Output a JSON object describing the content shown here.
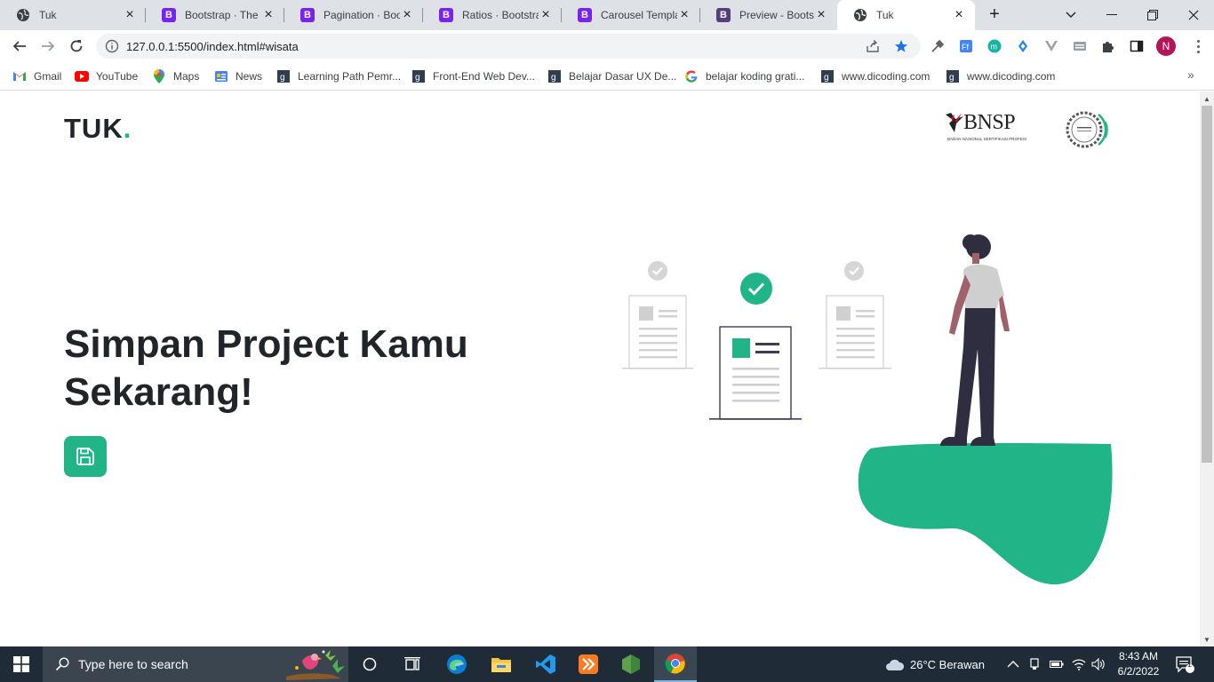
{
  "browser": {
    "tabs": [
      {
        "title": "Tuk",
        "icon": "globe-icon",
        "active": false
      },
      {
        "title": "Bootstrap · The m",
        "icon": "bootstrap-icon",
        "active": false
      },
      {
        "title": "Pagination · Boot",
        "icon": "bootstrap-icon",
        "active": false
      },
      {
        "title": "Ratios · Bootstrap",
        "icon": "bootstrap-icon",
        "active": false
      },
      {
        "title": "Carousel Templat",
        "icon": "bootstrap-icon",
        "active": false
      },
      {
        "title": "Preview - Bootstr",
        "icon": "bootstrap-icon",
        "active": false
      },
      {
        "title": "Tuk",
        "icon": "globe-icon",
        "active": true
      }
    ],
    "url": "127.0.0.1:5500/index.html#wisata",
    "profile_initial": "N",
    "bookmarks": [
      {
        "label": "Gmail",
        "icon": "gmail-icon"
      },
      {
        "label": "YouTube",
        "icon": "youtube-icon"
      },
      {
        "label": "Maps",
        "icon": "maps-icon"
      },
      {
        "label": "News",
        "icon": "news-icon"
      },
      {
        "label": "Learning Path Pemr...",
        "icon": "dicoding-icon"
      },
      {
        "label": "Front-End Web Dev...",
        "icon": "dicoding-icon"
      },
      {
        "label": "Belajar Dasar UX De...",
        "icon": "dicoding-icon"
      },
      {
        "label": "belajar koding grati...",
        "icon": "google-icon"
      },
      {
        "label": "www.dicoding.com",
        "icon": "dicoding-icon"
      },
      {
        "label": "www.dicoding.com",
        "icon": "dicoding-icon"
      }
    ]
  },
  "page": {
    "brand": "TUK",
    "brand_dot": ".",
    "logos": {
      "bnsp_word": "BNSP",
      "bnsp_sub": "BADAN NASIONAL SERTIFIKASI PROFESI"
    },
    "hero": {
      "title_line1": "Simpan Project Kamu",
      "title_line2": "Sekarang!"
    },
    "colors": {
      "accent": "#20b486",
      "text": "#212529"
    }
  },
  "taskbar": {
    "search_placeholder": "Type here to search",
    "weather": "26°C  Berawan",
    "time": "8:43 AM",
    "date": "6/2/2022",
    "notification_count": "1"
  }
}
